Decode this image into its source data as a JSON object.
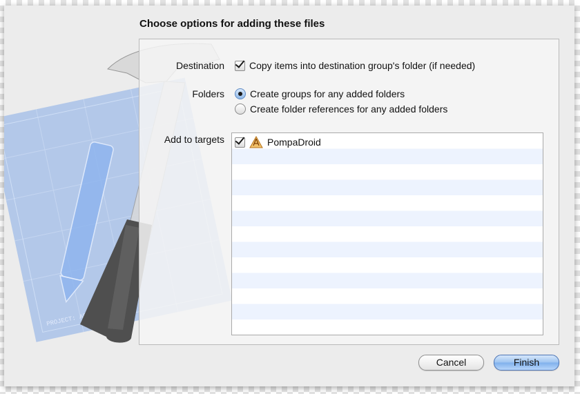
{
  "dialog": {
    "title": "Choose options for adding these files"
  },
  "destination": {
    "label": "Destination",
    "copy_items_label": "Copy items into destination group's folder (if needed)",
    "copy_items_checked": true
  },
  "folders": {
    "label": "Folders",
    "options": [
      {
        "label": "Create groups for any added folders",
        "selected": true
      },
      {
        "label": "Create folder references for any added folders",
        "selected": false
      }
    ]
  },
  "targets": {
    "label": "Add to targets",
    "items": [
      {
        "name": "PompaDroid",
        "checked": true,
        "icon": "application-target-icon"
      }
    ]
  },
  "buttons": {
    "cancel_label": "Cancel",
    "finish_label": "Finish"
  },
  "background_art": {
    "blueprint_text": "PROJECT: APPLICATION.APP",
    "icon": "xcode-hammer-blueprint-icon"
  },
  "colors": {
    "default_button": "#9cc3f0",
    "list_stripe": "#edf3fe",
    "sheet_background": "#ececec"
  }
}
